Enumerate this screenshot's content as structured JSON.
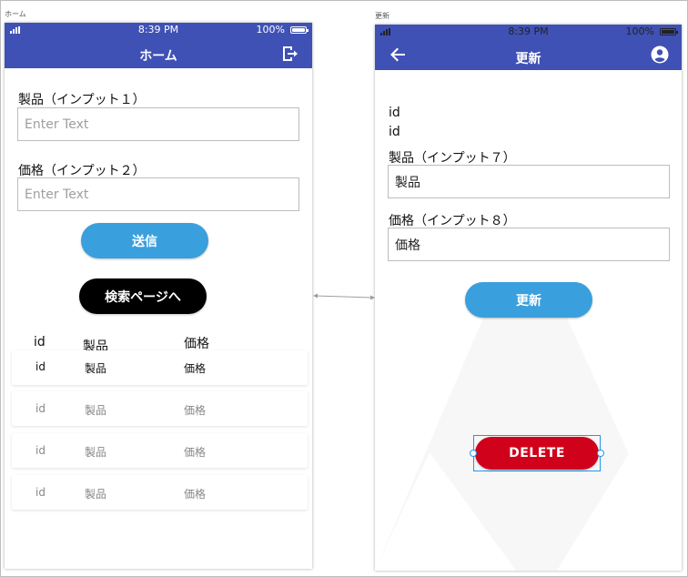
{
  "home": {
    "frame_label": "ホーム",
    "status": {
      "time": "8:39 PM",
      "battery": "100%"
    },
    "title": "ホーム",
    "icons": {
      "logout": "logout-icon",
      "signal": "signal-icon",
      "battery": "battery-icon"
    },
    "field1": {
      "label": "製品（インプット１）",
      "placeholder": "Enter Text"
    },
    "field2": {
      "label": "価格（インプット２）",
      "placeholder": "Enter Text"
    },
    "submit_label": "送信",
    "search_label": "検索ページへ",
    "table": {
      "headers": [
        "id",
        "製品",
        "価格"
      ],
      "rows": [
        [
          "id",
          "製品",
          "価格"
        ],
        [
          "id",
          "製品",
          "価格"
        ],
        [
          "id",
          "製品",
          "価格"
        ],
        [
          "id",
          "製品",
          "価格"
        ]
      ]
    }
  },
  "update": {
    "frame_label": "更新",
    "status": {
      "time": "8:39 PM",
      "battery": "100%"
    },
    "title": "更新",
    "icons": {
      "back": "arrow-left-icon",
      "account": "account-icon"
    },
    "id_line1": "id",
    "id_line2": "id",
    "field1": {
      "label": "製品（インプット７）",
      "value": "製品"
    },
    "field2": {
      "label": "価格（インプット８）",
      "value": "価格"
    },
    "update_label": "更新",
    "delete_label": "DELETE"
  },
  "colors": {
    "appbar": "#3f51b5",
    "primary_button": "#3a9fdd",
    "black_button": "#000000",
    "delete_button": "#d0021b"
  }
}
